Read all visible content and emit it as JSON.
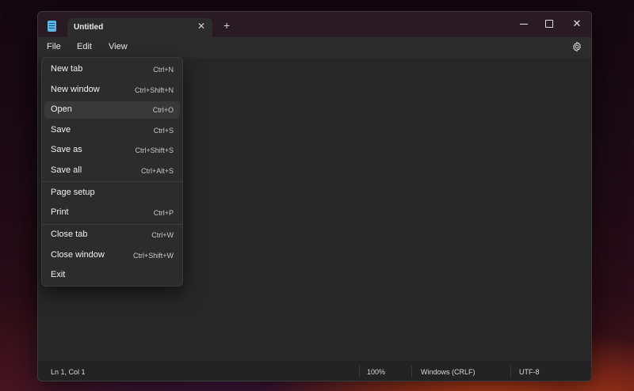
{
  "tab": {
    "title": "Untitled",
    "close": "✕",
    "new": "+"
  },
  "window_controls": {
    "close": "✕"
  },
  "menubar": {
    "file": "File",
    "edit": "Edit",
    "view": "View"
  },
  "file_menu": [
    {
      "label": "New tab",
      "shortcut": "Ctrl+N"
    },
    {
      "label": "New window",
      "shortcut": "Ctrl+Shift+N"
    },
    {
      "label": "Open",
      "shortcut": "Ctrl+O"
    },
    {
      "label": "Save",
      "shortcut": "Ctrl+S"
    },
    {
      "label": "Save as",
      "shortcut": "Ctrl+Shift+S"
    },
    {
      "label": "Save all",
      "shortcut": "Ctrl+Alt+S"
    },
    {
      "label": "Page setup",
      "shortcut": ""
    },
    {
      "label": "Print",
      "shortcut": "Ctrl+P"
    },
    {
      "label": "Close tab",
      "shortcut": "Ctrl+W"
    },
    {
      "label": "Close window",
      "shortcut": "Ctrl+Shift+W"
    },
    {
      "label": "Exit",
      "shortcut": ""
    }
  ],
  "statusbar": {
    "position": "Ln 1, Col 1",
    "zoom": "100%",
    "line_ending": "Windows (CRLF)",
    "encoding": "UTF-8"
  },
  "icons": {
    "app": "notepad-icon",
    "settings": "gear-icon"
  },
  "colors": {
    "window_bg": "#272727",
    "menu_bg": "#2c2c2c",
    "hover": "#383838",
    "app_icon": "#57b8e8"
  }
}
